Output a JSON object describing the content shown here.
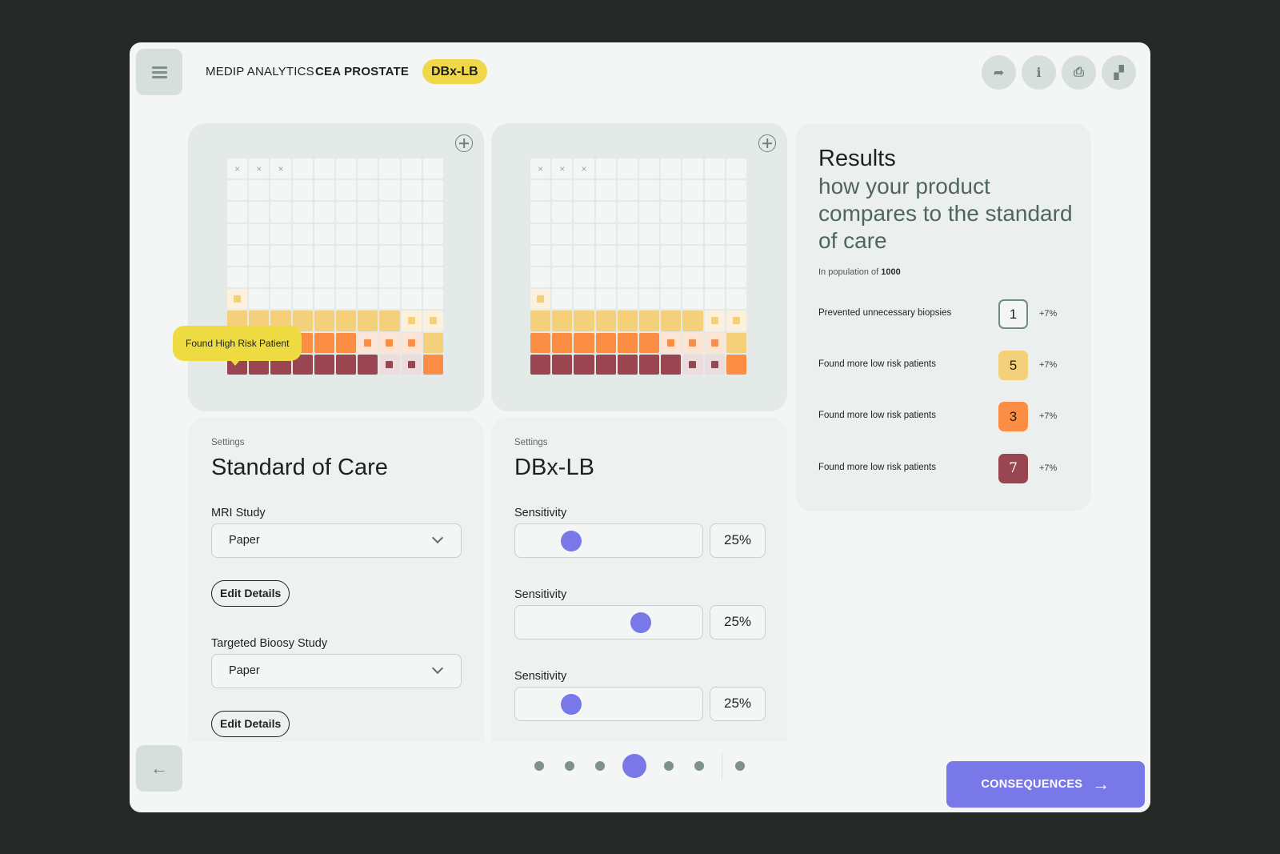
{
  "header": {
    "menu_icon": "hamburger-icon",
    "breadcrumb": [
      "MEDIP ANALYTICS",
      "CEA PROSTATE"
    ],
    "badge": "DBx-LB",
    "actions": [
      {
        "name": "share",
        "icon": "share-arrow-icon",
        "glyph": "➦"
      },
      {
        "name": "info",
        "icon": "info-icon",
        "glyph": "i"
      },
      {
        "name": "print",
        "icon": "printer-icon",
        "glyph": "⎙"
      },
      {
        "name": "layout",
        "icon": "blocks-icon",
        "glyph": "▞"
      }
    ]
  },
  "colors": {
    "accent": "#7878e8",
    "badge": "#f0d84a",
    "yellow": "#f4d07a",
    "orange": "#fb8d45",
    "maroon": "#9a4652",
    "tooltip": "#eedb42"
  },
  "waffles": [
    {
      "name": "standard-of-care",
      "tooltip": "Found High Risk Patient",
      "rows": [
        [
          "x",
          "x",
          "x",
          "e",
          "e",
          "e",
          "e",
          "e",
          "e",
          "e"
        ],
        [
          "e",
          "e",
          "e",
          "e",
          "e",
          "e",
          "e",
          "e",
          "e",
          "e"
        ],
        [
          "e",
          "e",
          "e",
          "e",
          "e",
          "e",
          "e",
          "e",
          "e",
          "e"
        ],
        [
          "e",
          "e",
          "e",
          "e",
          "e",
          "e",
          "e",
          "e",
          "e",
          "e"
        ],
        [
          "e",
          "e",
          "e",
          "e",
          "e",
          "e",
          "e",
          "e",
          "e",
          "e"
        ],
        [
          "e",
          "e",
          "e",
          "e",
          "e",
          "e",
          "e",
          "e",
          "e",
          "e"
        ],
        [
          "yd",
          "e",
          "e",
          "e",
          "e",
          "e",
          "e",
          "e",
          "e",
          "e"
        ],
        [
          "Y",
          "Y",
          "Y",
          "Y",
          "Y",
          "Y",
          "Y",
          "Y",
          "yd",
          "yd"
        ],
        [
          "O",
          "O",
          "O",
          "O",
          "O",
          "O",
          "od",
          "od",
          "od",
          "Y"
        ],
        [
          "M",
          "M",
          "M",
          "M",
          "M",
          "M",
          "M",
          "md",
          "md",
          "O"
        ]
      ]
    },
    {
      "name": "dbx-lb",
      "tooltip": null,
      "rows": [
        [
          "x",
          "x",
          "x",
          "e",
          "e",
          "e",
          "e",
          "e",
          "e",
          "e"
        ],
        [
          "e",
          "e",
          "e",
          "e",
          "e",
          "e",
          "e",
          "e",
          "e",
          "e"
        ],
        [
          "e",
          "e",
          "e",
          "e",
          "e",
          "e",
          "e",
          "e",
          "e",
          "e"
        ],
        [
          "e",
          "e",
          "e",
          "e",
          "e",
          "e",
          "e",
          "e",
          "e",
          "e"
        ],
        [
          "e",
          "e",
          "e",
          "e",
          "e",
          "e",
          "e",
          "e",
          "e",
          "e"
        ],
        [
          "e",
          "e",
          "e",
          "e",
          "e",
          "e",
          "e",
          "e",
          "e",
          "e"
        ],
        [
          "yd",
          "e",
          "e",
          "e",
          "e",
          "e",
          "e",
          "e",
          "e",
          "e"
        ],
        [
          "Y",
          "Y",
          "Y",
          "Y",
          "Y",
          "Y",
          "Y",
          "Y",
          "yd",
          "yd"
        ],
        [
          "O",
          "O",
          "O",
          "O",
          "O",
          "O",
          "od",
          "od",
          "od",
          "Y"
        ],
        [
          "M",
          "M",
          "M",
          "M",
          "M",
          "M",
          "M",
          "md",
          "md",
          "O"
        ]
      ]
    }
  ],
  "results": {
    "title": "Results",
    "subtitle": "how your product compares to the standard of care",
    "population_label": "In population of ",
    "population_value": "1000",
    "rows": [
      {
        "label": "Prevented unnecessary biopsies",
        "value": "1",
        "change": "+7%",
        "style": "outline"
      },
      {
        "label": "Found more low risk patients",
        "value": "5",
        "change": "+7%",
        "style": "yellow"
      },
      {
        "label": "Found more low risk patients",
        "value": "3",
        "change": "+7%",
        "style": "orange"
      },
      {
        "label": "Found more low risk patients",
        "value": "7",
        "change": "+7%",
        "style": "maroon"
      }
    ]
  },
  "settings_soc": {
    "eyebrow": "Settings",
    "title": "Standard of Care",
    "fields": [
      {
        "label": "MRI Study",
        "value": "Paper",
        "button": "Edit Details"
      },
      {
        "label": "Targeted Bioosy Study",
        "value": "Paper",
        "button": "Edit Details"
      }
    ]
  },
  "settings_dbx": {
    "eyebrow": "Settings",
    "title": "DBx-LB",
    "sliders": [
      {
        "label": "Sensitivity",
        "value": "25%",
        "thumb_fraction": 0.3
      },
      {
        "label": "Sensitivity",
        "value": "25%",
        "thumb_fraction": 0.67
      },
      {
        "label": "Sensitivity",
        "value": "25%",
        "thumb_fraction": 0.3
      }
    ]
  },
  "footer": {
    "back_icon": "arrow-left-icon",
    "pager": {
      "count": 7,
      "active": 3,
      "separator_before": 6
    },
    "cta_label": "CONSEQUENCES",
    "cta_icon": "arrow-right-icon"
  }
}
